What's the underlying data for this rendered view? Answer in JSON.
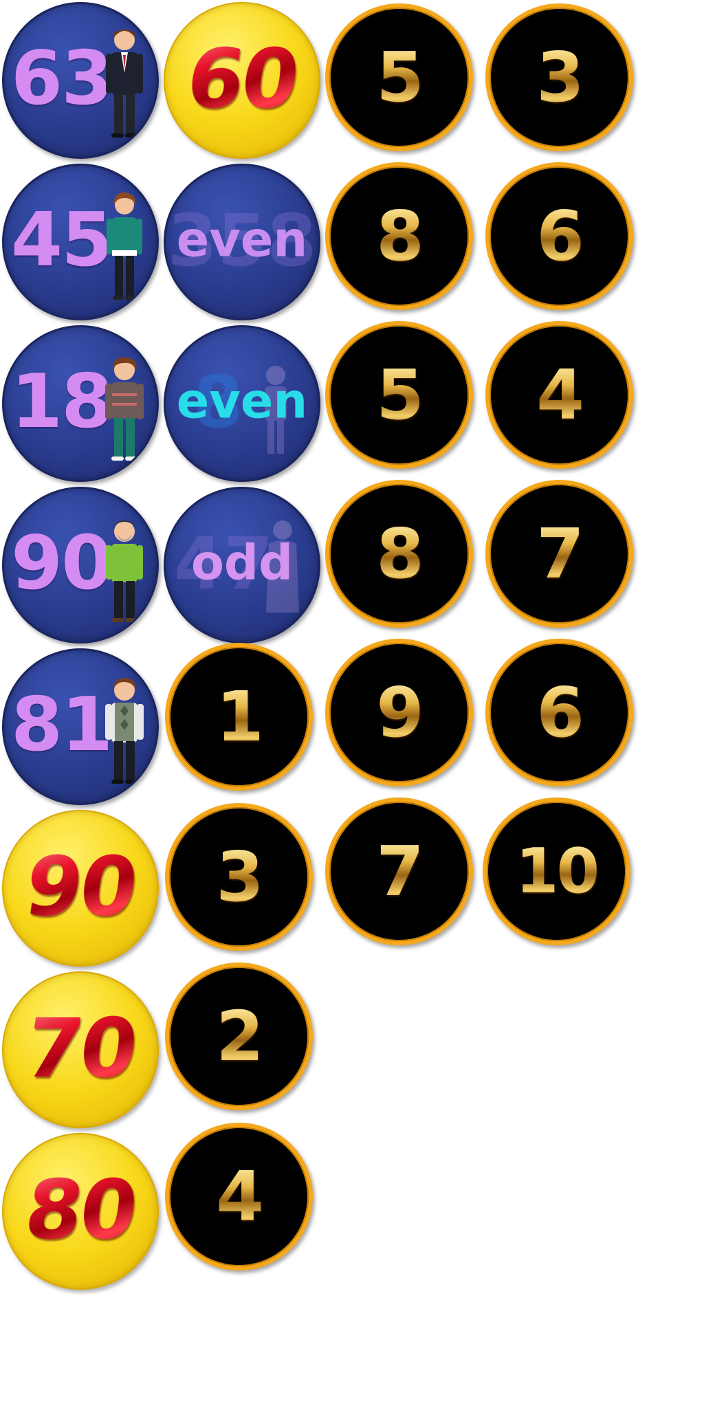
{
  "blue_discs": [
    {
      "number": "63",
      "word": ""
    },
    {
      "number": "45",
      "word": ""
    },
    {
      "number": "18",
      "word": ""
    },
    {
      "number": "90",
      "word": ""
    },
    {
      "number": "81",
      "word": ""
    }
  ],
  "word_discs": [
    {
      "word": "even",
      "ghost": "358",
      "word_color": "#c98ef0"
    },
    {
      "word": "even",
      "ghost": "8",
      "word_color": "#28dde8"
    },
    {
      "word": "odd",
      "ghost": "47",
      "word_color": "#d494f0"
    }
  ],
  "yellow_discs": [
    "60",
    "90",
    "70",
    "80"
  ],
  "black_discs_col2": [
    "1",
    "3",
    "2",
    "4"
  ],
  "black_discs_col3": [
    "5",
    "8",
    "5",
    "8",
    "9",
    "7"
  ],
  "black_discs_col4": [
    "3",
    "6",
    "4",
    "7",
    "6",
    "10"
  ],
  "colors": {
    "blue_disc": "#2a3c8f",
    "blue_number": "#d48cf2",
    "yellow_disc": "#f8d81a",
    "red_number": "#e8142a",
    "black_disc": "#000000",
    "gold_rim": "#f5a81c",
    "gold_number": "#e0b44a"
  }
}
